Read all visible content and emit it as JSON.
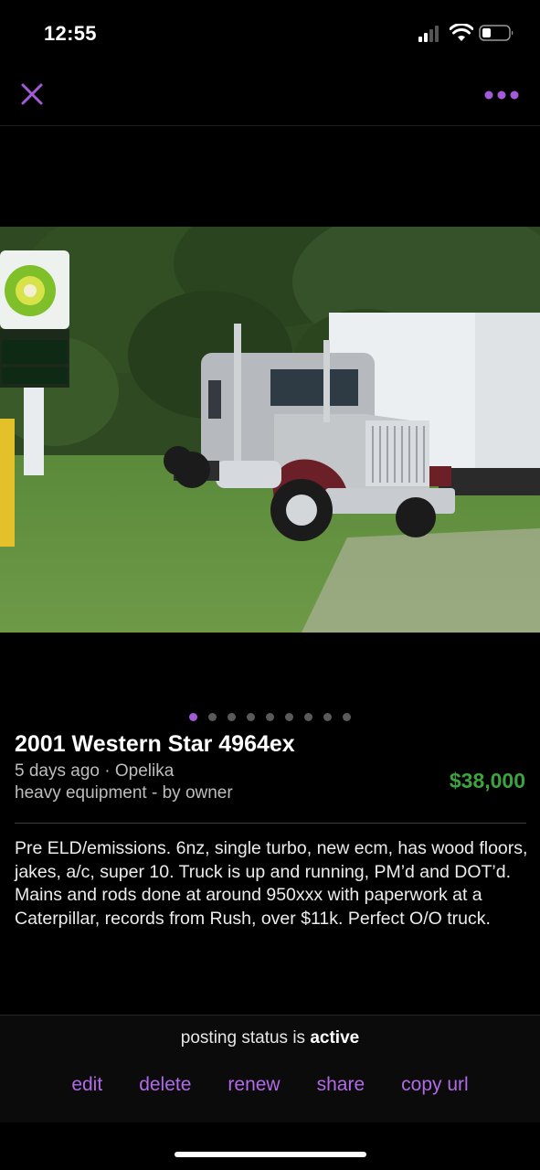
{
  "status_bar": {
    "time": "12:55",
    "icons": [
      "cellular-signal-icon",
      "wifi-icon",
      "battery-icon"
    ]
  },
  "nav": {
    "close_icon": "close-icon",
    "more_icon": "more-dots-icon"
  },
  "gallery": {
    "photo_count": 9,
    "active_index": 0,
    "photo_subject": "truck-photo"
  },
  "listing": {
    "title": "2001 Western Star 4964ex",
    "posted": "5 days ago · Opelika",
    "category": "heavy equipment - by owner",
    "price": "$38,000",
    "description": "Pre ELD/emissions. 6nz, single turbo, new ecm, has wood floors, jakes, a/c, super 10. Truck is up and running, PM’d and DOT’d. Mains and rods done at around 950xxx with paperwork at a Caterpillar, records from Rush, over $11k. Perfect O/O truck."
  },
  "footer": {
    "status_prefix": "posting status is",
    "status_value": "active",
    "actions": {
      "edit": "edit",
      "delete": "delete",
      "renew": "renew",
      "share": "share",
      "copy_url": "copy url"
    }
  },
  "colors": {
    "accent": "#a35ad8",
    "price": "#3ea33e",
    "link": "#b26ae8"
  }
}
